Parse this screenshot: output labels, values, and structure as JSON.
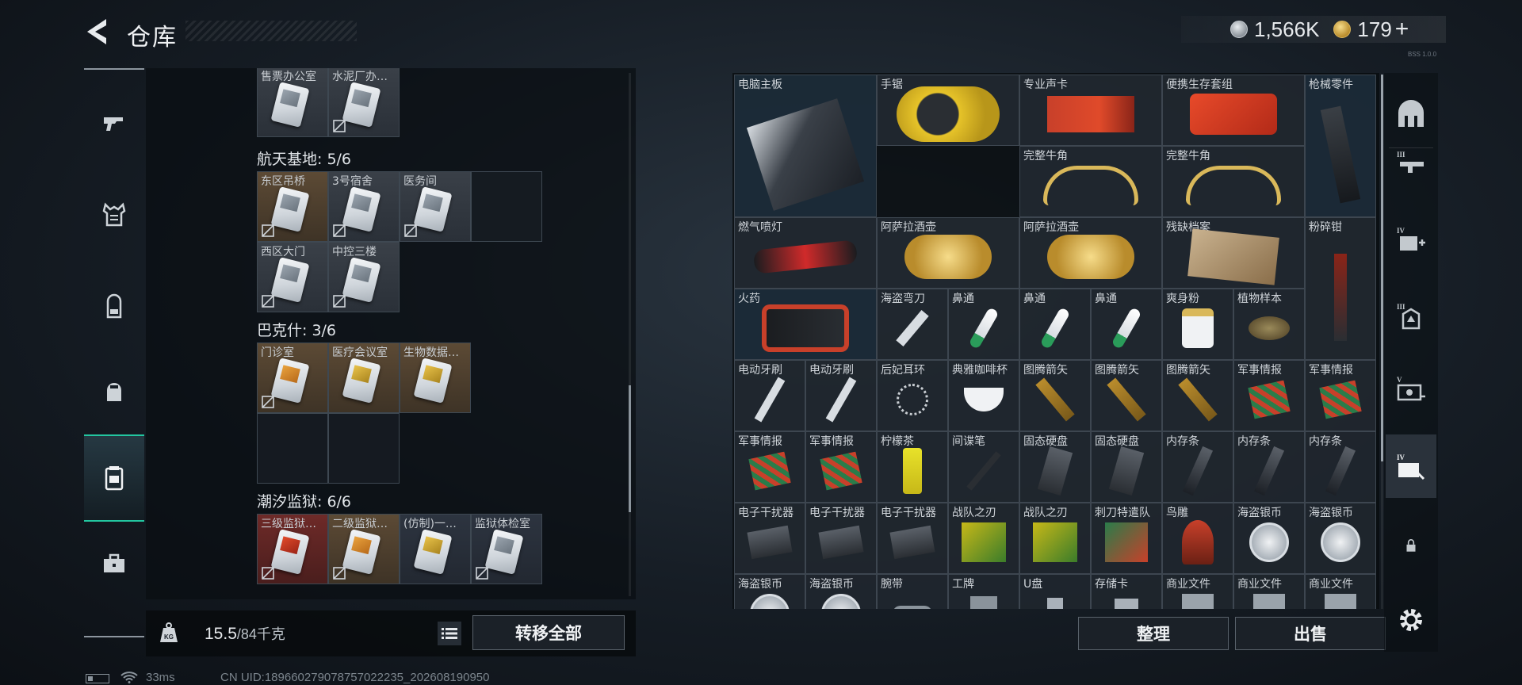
{
  "header": {
    "title": "仓库",
    "currency": {
      "silver": "1,566K",
      "gold": "179",
      "add": "+"
    },
    "version_tag": "BSS 1.0.0"
  },
  "left_rail": [
    {
      "id": "guns",
      "icon": "pistol-icon"
    },
    {
      "id": "armor",
      "icon": "armor-vest-icon"
    },
    {
      "id": "backpack",
      "icon": "backpack-icon"
    },
    {
      "id": "helmet",
      "icon": "bag-icon"
    },
    {
      "id": "keycards",
      "icon": "keycard-holder-icon",
      "active": true
    },
    {
      "id": "case",
      "icon": "briefcase-icon"
    }
  ],
  "storage": {
    "sections": [
      {
        "title": "",
        "cards": [
          "售票办公室",
          "水泥厂办…"
        ]
      },
      {
        "title": "航天基地: 5/6",
        "cards": [
          "东区吊桥",
          "3号宿舍",
          "医务间",
          "西区大门",
          "中控三楼"
        ]
      },
      {
        "title": "巴克什: 3/6",
        "cards": [
          "门诊室",
          "医疗会议室",
          "生物数据…"
        ]
      },
      {
        "title": "潮汐监狱: 6/6",
        "cards": [
          "三级监狱…",
          "二级监狱…",
          "(仿制)一…",
          "监狱体检室"
        ]
      }
    ],
    "weight_current": "15.5",
    "weight_max": "/84千克",
    "transfer_all": "转移全部"
  },
  "inventory": {
    "items": [
      "电脑主板",
      "手锯",
      "专业声卡",
      "便携生存套组",
      "枪械零件",
      "完整牛角",
      "完整牛角",
      "燃气喷灯",
      "阿萨拉酒壶",
      "阿萨拉酒壶",
      "残缺档案",
      "粉碎钳",
      "火药",
      "海盗弯刀",
      "鼻通",
      "鼻通",
      "鼻通",
      "爽身粉",
      "植物样本",
      "电动牙刷",
      "电动牙刷",
      "后妃耳环",
      "典雅咖啡杯",
      "图腾箭矢",
      "图腾箭矢",
      "图腾箭矢",
      "军事情报",
      "军事情报",
      "军事情报",
      "军事情报",
      "柠檬茶",
      "间谍笔",
      "固态硬盘",
      "固态硬盘",
      "内存条",
      "内存条",
      "内存条",
      "电子干扰器",
      "电子干扰器",
      "电子干扰器",
      "战队之刃",
      "战队之刃",
      "刺刀特遣队",
      "鸟雕",
      "海盗银币",
      "海盗银币",
      "海盗银币",
      "海盗银币",
      "腕带",
      "工牌",
      "U盘",
      "存储卡",
      "商业文件",
      "商业文件",
      "商业文件"
    ],
    "sort_label": "整理",
    "sell_label": "出售"
  },
  "right_tabs": [
    "fort-icon",
    "tier3-rifle-icon",
    "tier4-medkit-icon",
    "tier3-backpack-icon",
    "tier5-armor-icon",
    "tier4-keycard-icon",
    "lock-icon",
    "settings-icon"
  ],
  "status": {
    "ping": "33ms",
    "uid": "CN UID:18966027907875702223‌5_202608190950"
  },
  "colors": {
    "accent": "#23c6a0",
    "panel": "#0a0e12",
    "cell": "#2c343e"
  }
}
